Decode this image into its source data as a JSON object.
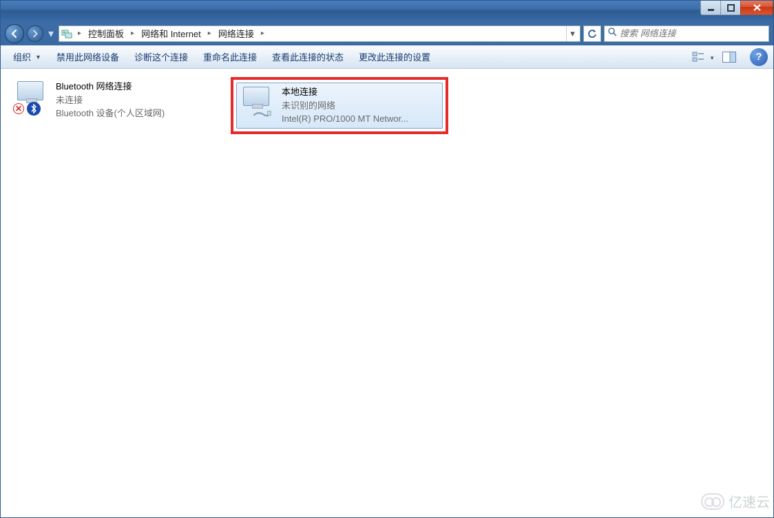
{
  "breadcrumbs": {
    "item1": "控制面板",
    "item2": "网络和 Internet",
    "item3": "网络连接"
  },
  "search": {
    "placeholder": "搜索 网络连接"
  },
  "toolbar": {
    "organize": "组织",
    "disable": "禁用此网络设备",
    "diagnose": "诊断这个连接",
    "rename": "重命名此连接",
    "status": "查看此连接的状态",
    "change": "更改此连接的设置"
  },
  "connections": {
    "bluetooth": {
      "title": "Bluetooth 网络连接",
      "sub": "未连接",
      "sub2": "Bluetooth 设备(个人区域网)"
    },
    "lan": {
      "title": "本地连接",
      "sub": "未识别的网络",
      "sub2": "Intel(R) PRO/1000 MT Networ..."
    }
  },
  "help_char": "?",
  "watermark": "亿速云"
}
